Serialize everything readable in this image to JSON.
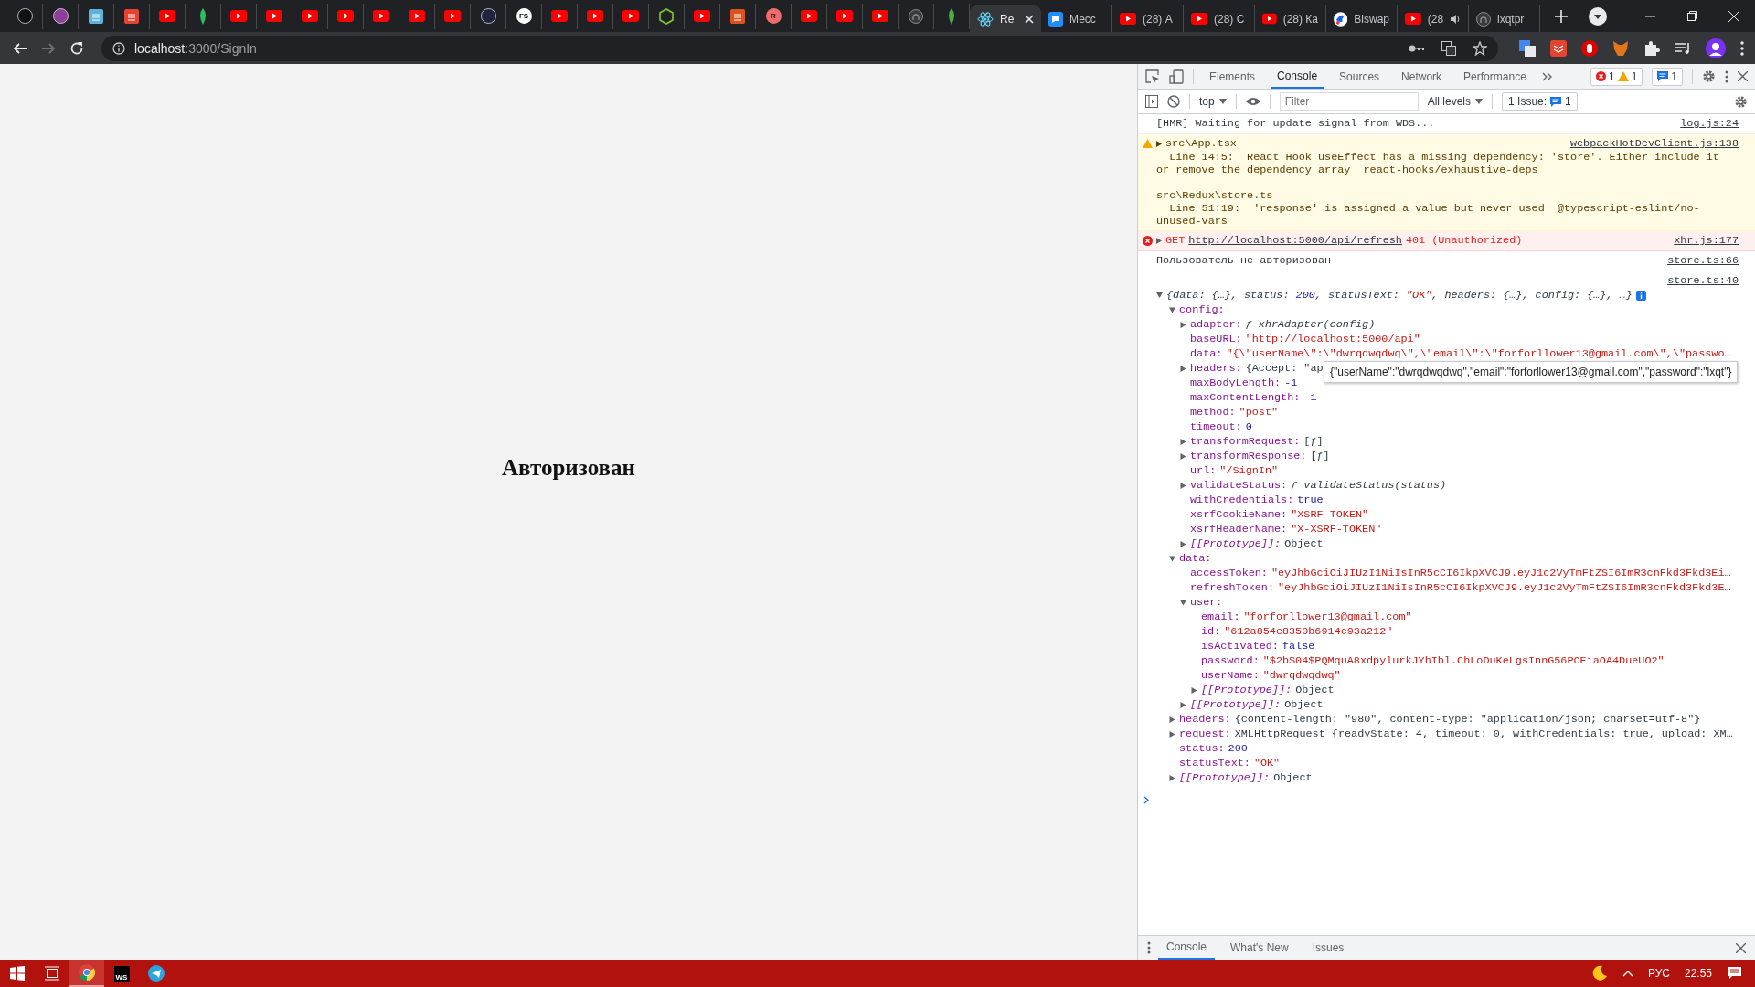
{
  "browser": {
    "pinned_tabs": [
      {
        "kind": "dot",
        "color": "#111111"
      },
      {
        "kind": "dot",
        "color": "#8e3f9e"
      },
      {
        "kind": "square",
        "color": "#5fb3d9"
      },
      {
        "kind": "square",
        "color": "#e44332"
      },
      {
        "kind": "youtube"
      },
      {
        "kind": "leaf",
        "color": "#2dbe60"
      },
      {
        "kind": "youtube"
      },
      {
        "kind": "youtube"
      },
      {
        "kind": "youtube"
      },
      {
        "kind": "youtube"
      },
      {
        "kind": "youtube"
      },
      {
        "kind": "youtube"
      },
      {
        "kind": "youtube"
      },
      {
        "kind": "dot",
        "color": "#1f2340"
      },
      {
        "kind": "letter",
        "label": "FS",
        "color": "#ffffff"
      },
      {
        "kind": "youtube"
      },
      {
        "kind": "youtube"
      },
      {
        "kind": "youtube"
      },
      {
        "kind": "hexagon",
        "color": "#83cd29"
      },
      {
        "kind": "youtube"
      },
      {
        "kind": "square",
        "color": "#d9531e"
      },
      {
        "kind": "letter",
        "label": "R",
        "color": "#f26b6b"
      },
      {
        "kind": "youtube"
      },
      {
        "kind": "youtube"
      },
      {
        "kind": "youtube"
      },
      {
        "kind": "github"
      },
      {
        "kind": "leaf",
        "color": "#4faa41"
      }
    ],
    "tabs": [
      {
        "title": "Re",
        "kind": "react",
        "selected": true,
        "audio": false
      },
      {
        "title": "Месс",
        "kind": "chat",
        "selected": false,
        "audio": false
      },
      {
        "title": "(28) А",
        "kind": "youtube",
        "selected": false,
        "audio": false
      },
      {
        "title": "(28) С",
        "kind": "youtube",
        "selected": false,
        "audio": false
      },
      {
        "title": "(28) Ка",
        "kind": "youtube",
        "selected": false,
        "audio": false
      },
      {
        "title": "Biswap",
        "kind": "bird",
        "selected": false,
        "audio": false
      },
      {
        "title": "(28",
        "kind": "youtube",
        "selected": false,
        "audio": true
      },
      {
        "title": "lxqtpr",
        "kind": "github",
        "selected": false,
        "audio": false
      }
    ],
    "nav": {
      "back_disabled": false,
      "forward_disabled": true
    },
    "url": {
      "host": "localhost",
      "path": ":3000/SignIn"
    }
  },
  "page": {
    "heading": "Авторизован"
  },
  "devtools": {
    "tabs": [
      {
        "label": "Elements",
        "selected": false
      },
      {
        "label": "Console",
        "selected": true
      },
      {
        "label": "Sources",
        "selected": false
      },
      {
        "label": "Network",
        "selected": false
      },
      {
        "label": "Performance",
        "selected": false
      }
    ],
    "counts": {
      "errors": "1",
      "warnings": "1",
      "messages": "1"
    },
    "toolbar": {
      "context": "top",
      "filter_placeholder": "Filter",
      "levels": "All levels",
      "issues_label": "1 Issue:",
      "issues_count": "1"
    },
    "messages": [
      {
        "kind": "log",
        "text": "[HMR] Waiting for update signal from WDS...",
        "source": "log.js:24"
      },
      {
        "kind": "warning",
        "summary": "src\\App.tsx",
        "expanded": false,
        "text": "  Line 14:5:  React Hook useEffect has a missing dependency: 'store'. Either include it\nor remove the dependency array  react-hooks/exhaustive-deps\n\nsrc\\Redux\\store.ts\n  Line 51:19:  'response' is assigned a value but never used  @typescript-eslint/no-\nunused-vars",
        "source": "webpackHotDevClient.js:138"
      },
      {
        "kind": "error",
        "method": "GET",
        "url": "http://localhost:5000/api/refresh",
        "status": "401 (Unauthorized)",
        "expanded": false,
        "source": "xhr.js:177"
      },
      {
        "kind": "log",
        "text": "Пользователь не авторизован",
        "source": "store.ts:66"
      },
      {
        "kind": "object",
        "source": "store.ts:40",
        "expanded": true,
        "preview": [
          {
            "text": "{data: {…}, status: ",
            "kind": "plain"
          },
          {
            "text": "200",
            "kind": "number"
          },
          {
            "text": ", statusText: ",
            "kind": "plain"
          },
          {
            "text": "\"OK\"",
            "kind": "string"
          },
          {
            "text": ", headers: {…}, config: {…}, …}",
            "kind": "plain"
          }
        ],
        "tree": [
          {
            "key": "config:",
            "expanded": true,
            "children": [
              {
                "key": "adapter:",
                "value": "ƒ xhrAdapter(config)",
                "kind": "function",
                "expanded": false
              },
              {
                "key": "baseURL:",
                "value": "\"http://localhost:5000/api\"",
                "kind": "string"
              },
              {
                "key": "data:",
                "value": "\"{\\\"userName\\\":\\\"dwrqdwqdwq\\\",\\\"email\\\":\\\"forforllower13@gmail.com\\\",\\\"passwo…",
                "kind": "string"
              },
              {
                "key": "headers:",
                "value": "{Accept: \"ap",
                "kind": "object",
                "expanded": false
              },
              {
                "key": "maxBodyLength:",
                "value": "-1",
                "kind": "number"
              },
              {
                "key": "maxContentLength:",
                "value": "-1",
                "kind": "number"
              },
              {
                "key": "method:",
                "value": "\"post\"",
                "kind": "string"
              },
              {
                "key": "timeout:",
                "value": "0",
                "kind": "number"
              },
              {
                "key": "transformRequest:",
                "value": "[ƒ]",
                "kind": "object",
                "expanded": false
              },
              {
                "key": "transformResponse:",
                "value": "[ƒ]",
                "kind": "object",
                "expanded": false
              },
              {
                "key": "url:",
                "value": "\"/SignIn\"",
                "kind": "string"
              },
              {
                "key": "validateStatus:",
                "value": "ƒ validateStatus(status)",
                "kind": "function",
                "expanded": false
              },
              {
                "key": "withCredentials:",
                "value": "true",
                "kind": "boolean"
              },
              {
                "key": "xsrfCookieName:",
                "value": "\"XSRF-TOKEN\"",
                "kind": "string"
              },
              {
                "key": "xsrfHeaderName:",
                "value": "\"X-XSRF-TOKEN\"",
                "kind": "string"
              },
              {
                "key": "[[Prototype]]:",
                "value": "Object",
                "kind": "prototype",
                "expanded": false
              }
            ]
          },
          {
            "key": "data:",
            "expanded": true,
            "children": [
              {
                "key": "accessToken:",
                "value": "\"eyJhbGciOiJIUzI1NiIsInR5cCI6IkpXVCJ9.eyJ1c2VyTmFtZSI6ImR3cnFkd3Fkd3Ei…",
                "kind": "string"
              },
              {
                "key": "refreshToken:",
                "value": "\"eyJhbGciOiJIUzI1NiIsInR5cCI6IkpXVCJ9.eyJ1c2VyTmFtZSI6ImR3cnFkd3Fkd3E…",
                "kind": "string"
              },
              {
                "key": "user:",
                "expanded": true,
                "children": [
                  {
                    "key": "email:",
                    "value": "\"forforllower13@gmail.com\"",
                    "kind": "string"
                  },
                  {
                    "key": "id:",
                    "value": "\"612a854e8350b6914c93a212\"",
                    "kind": "string"
                  },
                  {
                    "key": "isActivated:",
                    "value": "false",
                    "kind": "boolean"
                  },
                  {
                    "key": "password:",
                    "value": "\"$2b$04$PQMquA8xdpylurkJYhIbl.ChLoDuKeLgsInnG56PCEiaOA4DueUO2\"",
                    "kind": "string"
                  },
                  {
                    "key": "userName:",
                    "value": "\"dwrqdwqdwq\"",
                    "kind": "string"
                  },
                  {
                    "key": "[[Prototype]]:",
                    "value": "Object",
                    "kind": "prototype",
                    "expanded": false
                  }
                ]
              },
              {
                "key": "[[Prototype]]:",
                "value": "Object",
                "kind": "prototype",
                "expanded": false
              }
            ]
          },
          {
            "key": "headers:",
            "value": "{content-length: \"980\", content-type: \"application/json; charset=utf-8\"}",
            "kind": "object",
            "expanded": false
          },
          {
            "key": "request:",
            "value": "XMLHttpRequest {readyState: 4, timeout: 0, withCredentials: true, upload: XM…",
            "kind": "object",
            "expanded": false
          },
          {
            "key": "status:",
            "value": "200",
            "kind": "number"
          },
          {
            "key": "statusText:",
            "value": "\"OK\"",
            "kind": "string"
          },
          {
            "key": "[[Prototype]]:",
            "value": "Object",
            "kind": "prototype",
            "expanded": false
          }
        ]
      }
    ],
    "tooltip": "{\"userName\":\"dwrqdwqdwq\",\"email\":\"forforllower13@gmail.com\",\"password\":\"lxqt\"}",
    "drawer_tabs": [
      {
        "label": "Console",
        "selected": true
      },
      {
        "label": "What's New",
        "selected": false
      },
      {
        "label": "Issues",
        "selected": false
      }
    ]
  },
  "taskbar": {
    "apps": [
      {
        "kind": "chrome",
        "active": true
      },
      {
        "kind": "letter",
        "label": "WS",
        "active": false
      },
      {
        "kind": "telegram",
        "active": false
      }
    ],
    "language": "РУС",
    "time": "22:55"
  }
}
